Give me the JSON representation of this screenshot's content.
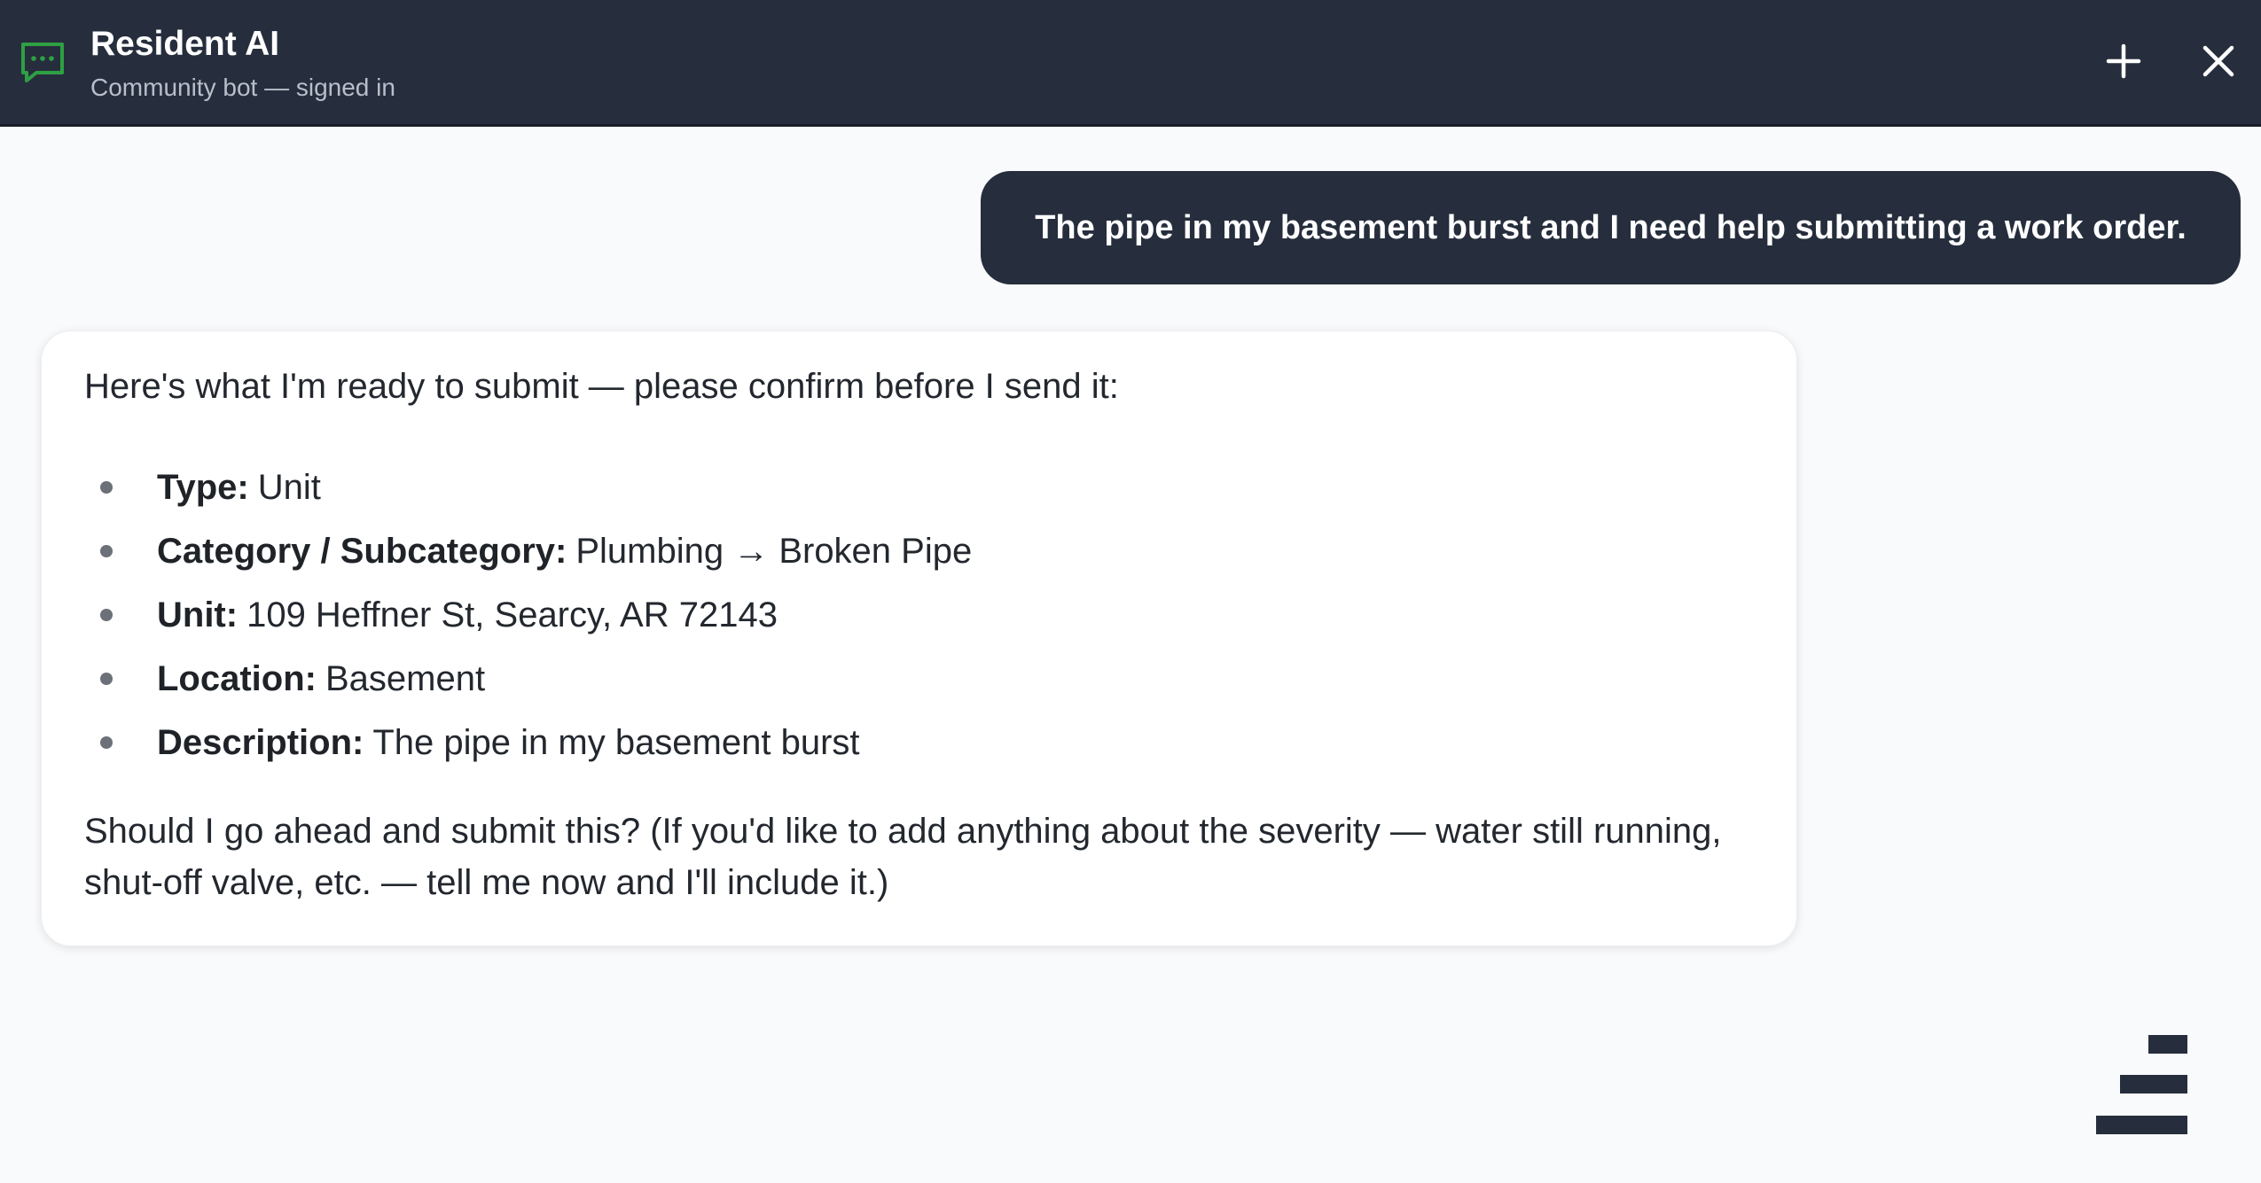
{
  "header": {
    "title": "Resident AI",
    "subtitle": "Community bot — signed in",
    "icons": {
      "app": "chat-bubble-icon",
      "new": "plus-icon",
      "close": "close-icon"
    },
    "colors": {
      "bar": "#262e3d",
      "accent": "#2ea043"
    }
  },
  "conversation": {
    "user_message": "The pipe in my basement burst and I need help submitting a work order.",
    "bot_message": {
      "intro": "Here's what I'm ready to submit — please confirm before I send it:",
      "items": [
        {
          "label": "Type:",
          "value": "Unit"
        },
        {
          "label": "Category / Subcategory:",
          "value": "Plumbing → Broken Pipe"
        },
        {
          "label": "Unit:",
          "value": "109 Heffner St, Searcy, AR 72143"
        },
        {
          "label": "Location:",
          "value": "Basement"
        },
        {
          "label": "Description:",
          "value": "The pipe in my basement burst"
        }
      ],
      "outro": "Should I go ahead and submit this? (If you'd like to add anything about the severity — water still running, shut-off valve, etc. — tell me now and I'll include it.)"
    }
  },
  "footer": {
    "logo_icon": "brand-logo-icon"
  }
}
